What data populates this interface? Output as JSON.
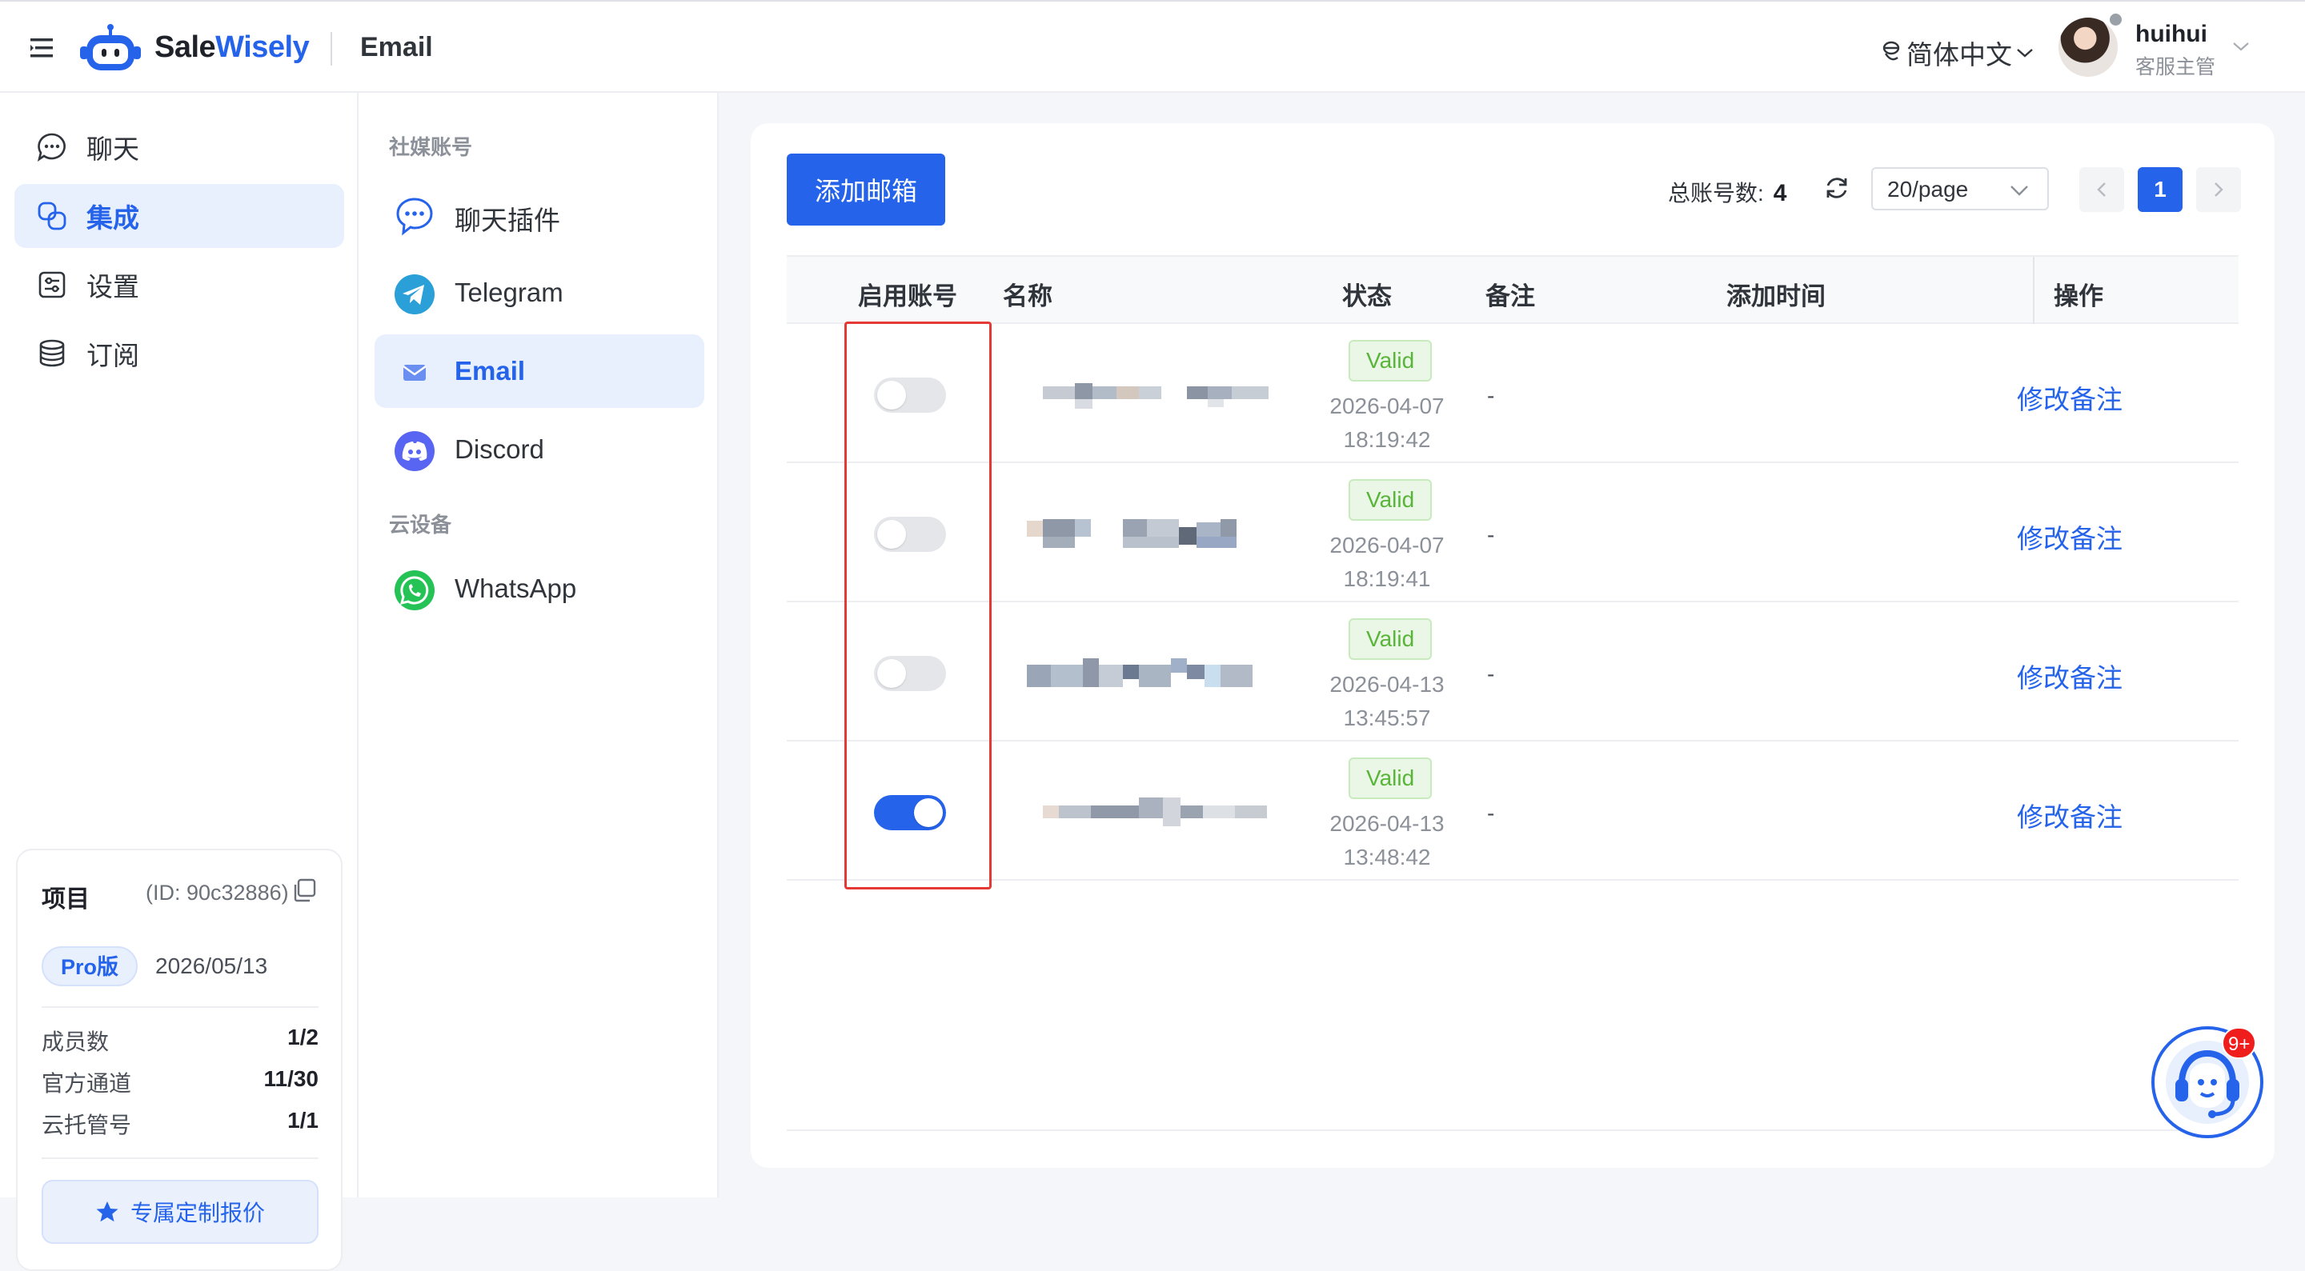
{
  "header": {
    "brand_part1": "Sale",
    "brand_part2": "Wisely",
    "breadcrumb": "Email",
    "language": "简体中文",
    "user_name": "huihui",
    "user_role": "客服主管"
  },
  "nav": {
    "items": [
      {
        "label": "聊天",
        "icon": "chat-icon"
      },
      {
        "label": "集成",
        "icon": "integration-icon",
        "active": true
      },
      {
        "label": "设置",
        "icon": "settings-icon"
      },
      {
        "label": "订阅",
        "icon": "subscription-icon"
      }
    ]
  },
  "project": {
    "title": "项目",
    "id_text": "(ID: 90c32886)",
    "plan": "Pro版",
    "expiry": "2026/05/13",
    "stats": [
      {
        "label": "成员数",
        "value": "1/2"
      },
      {
        "label": "官方通道",
        "value": "11/30"
      },
      {
        "label": "云托管号",
        "value": "1/1"
      }
    ],
    "quote_button": "专属定制报价"
  },
  "subnav": {
    "group_social": "社媒账号",
    "group_cloud": "云设备",
    "items": [
      {
        "label": "聊天插件",
        "icon": "chat-plugin-icon"
      },
      {
        "label": "Telegram",
        "icon": "telegram-icon"
      },
      {
        "label": "Email",
        "icon": "email-icon",
        "active": true
      },
      {
        "label": "Discord",
        "icon": "discord-icon"
      },
      {
        "label": "WhatsApp",
        "icon": "whatsapp-icon"
      }
    ]
  },
  "toolbar": {
    "add_button": "添加邮箱",
    "total_label": "总账号数:",
    "total_value": "4",
    "page_size": "20/page",
    "current_page": "1"
  },
  "table": {
    "columns": [
      "启用账号",
      "名称",
      "状态",
      "备注",
      "添加时间",
      "操作"
    ],
    "rows": [
      {
        "enabled": false,
        "status": "Valid",
        "date": "2026-04-07",
        "time": "18:19:42",
        "note": "-",
        "action": "修改备注"
      },
      {
        "enabled": false,
        "status": "Valid",
        "date": "2026-04-07",
        "time": "18:19:41",
        "note": "-",
        "action": "修改备注"
      },
      {
        "enabled": false,
        "status": "Valid",
        "date": "2026-04-13",
        "time": "13:45:57",
        "note": "-",
        "action": "修改备注"
      },
      {
        "enabled": true,
        "status": "Valid",
        "date": "2026-04-13",
        "time": "13:48:42",
        "note": "-",
        "action": "修改备注"
      }
    ]
  },
  "support": {
    "badge": "9+"
  },
  "colors": {
    "accent": "#2563eb",
    "valid": "#58b53a",
    "highlight": "#e53935"
  }
}
